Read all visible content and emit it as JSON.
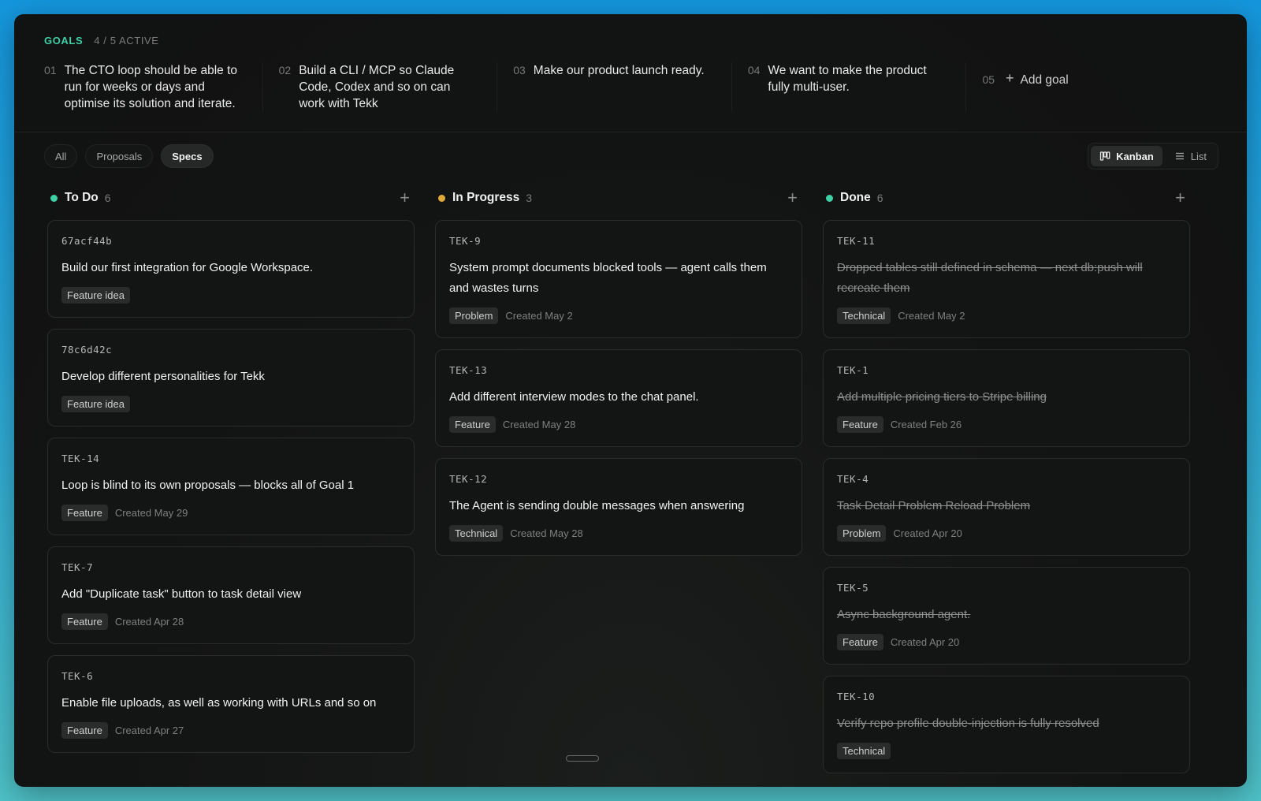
{
  "goals": {
    "title": "GOALS",
    "count": "4 / 5 ACTIVE",
    "items": [
      {
        "num": "01",
        "text": "The CTO loop should be able to run for weeks or days and optimise its solution and iterate."
      },
      {
        "num": "02",
        "text": "Build a CLI / MCP so Claude Code, Codex and so on can work with Tekk"
      },
      {
        "num": "03",
        "text": "Make our product launch ready."
      },
      {
        "num": "04",
        "text": "We want to make the product fully multi-user."
      }
    ],
    "add": {
      "num": "05",
      "plus": "+",
      "label": "Add goal"
    }
  },
  "filters": {
    "all": "All",
    "proposals": "Proposals",
    "specs": "Specs",
    "active": "Specs"
  },
  "view": {
    "kanban": "Kanban",
    "list": "List",
    "active": "Kanban"
  },
  "colors": {
    "accent": "#3fd0a6",
    "todo": "#3fd0a6",
    "in_progress": "#e0a93a",
    "done": "#3fd0a6"
  },
  "columns": [
    {
      "title": "To Do",
      "count": "6",
      "status_color": "#3fd0a6",
      "cards": [
        {
          "id": "67acf44b",
          "title": "Build our first integration for Google Workspace.",
          "tag": "Feature idea",
          "created": ""
        },
        {
          "id": "78c6d42c",
          "title": "Develop different personalities for Tekk",
          "tag": "Feature idea",
          "created": ""
        },
        {
          "id": "TEK-14",
          "title": "Loop is blind to its own proposals — blocks all of Goal 1",
          "tag": "Feature",
          "created": "Created May 29"
        },
        {
          "id": "TEK-7",
          "title": "Add \"Duplicate task\" button to task detail view",
          "tag": "Feature",
          "created": "Created Apr 28"
        },
        {
          "id": "TEK-6",
          "title": "Enable file uploads, as well as working with URLs and so on",
          "tag": "Feature",
          "created": "Created Apr 27"
        }
      ]
    },
    {
      "title": "In Progress",
      "count": "3",
      "status_color": "#e0a93a",
      "cards": [
        {
          "id": "TEK-9",
          "title": "System prompt documents blocked tools — agent calls them and wastes turns",
          "tag": "Problem",
          "created": "Created May 2"
        },
        {
          "id": "TEK-13",
          "title": "Add different interview modes to the chat panel.",
          "tag": "Feature",
          "created": "Created May 28"
        },
        {
          "id": "TEK-12",
          "title": "The Agent is sending double messages when answering",
          "tag": "Technical",
          "created": "Created May 28"
        }
      ]
    },
    {
      "title": "Done",
      "count": "6",
      "status_color": "#3fd0a6",
      "cards": [
        {
          "id": "TEK-11",
          "title": "Dropped tables still defined in schema — next db:push will recreate them",
          "tag": "Technical",
          "created": "Created May 2"
        },
        {
          "id": "TEK-1",
          "title": "Add multiple pricing tiers to Stripe billing",
          "tag": "Feature",
          "created": "Created Feb 26"
        },
        {
          "id": "TEK-4",
          "title": "Task Detail Problem Reload Problem",
          "tag": "Problem",
          "created": "Created Apr 20"
        },
        {
          "id": "TEK-5",
          "title": "Async background agent.",
          "tag": "Feature",
          "created": "Created Apr 20"
        },
        {
          "id": "TEK-10",
          "title": "Verify repo profile double-injection is fully resolved",
          "tag": "Technical",
          "created": ""
        }
      ]
    }
  ]
}
